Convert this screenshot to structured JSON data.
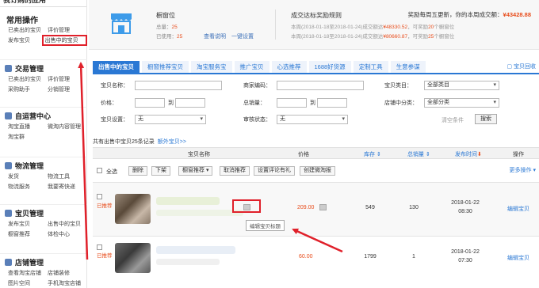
{
  "sidebar": {
    "top_title": "我订购的应用",
    "common": {
      "title": "常用操作",
      "rows": [
        [
          "已卖出的宝贝",
          "评价管理"
        ],
        [
          "发布宝贝",
          "出售中的宝贝"
        ]
      ]
    },
    "sections": [
      {
        "title": "交易管理",
        "rows": [
          [
            "已卖出的宝贝",
            "评价管理"
          ],
          [
            "采购助手",
            "分销管理"
          ]
        ]
      },
      {
        "title": "自运营中心",
        "rows": [
          [
            "淘宝直播",
            "微淘内容管理"
          ],
          [
            "淘宝群",
            ""
          ]
        ]
      },
      {
        "title": "物流管理",
        "rows": [
          [
            "发货",
            "物流工具"
          ],
          [
            "物流服务",
            "我要寄快递"
          ]
        ]
      },
      {
        "title": "宝贝管理",
        "rows": [
          [
            "发布宝贝",
            "出售中的宝贝"
          ],
          [
            "橱窗推荐",
            "体检中心"
          ]
        ]
      },
      {
        "title": "店铺管理",
        "rows": [
          [
            "查看淘宝店铺",
            "店铺装修"
          ],
          [
            "图片空间",
            "手机淘宝店铺"
          ]
        ]
      }
    ]
  },
  "topcard": {
    "title": "橱窗位",
    "total_label": "总量：",
    "total_value": "25",
    "used_label": "已使用：",
    "used_value": "25",
    "link_view": "查看说明",
    "link_setting": "一键设置",
    "rule_title": "成交达标奖励规则",
    "week1": "本周(2018-01-18至2018-01-24)成交额达",
    "week1_amount": "¥48330.52",
    "week1_tail": "，可奖励",
    "week1_num": "20",
    "week1_end": "个橱窗位",
    "week2": "本周(2018-01-18至2018-01-24)成交额达",
    "week2_amount": "¥80660.87",
    "week2_tail": "，可奖励",
    "week2_num": "25",
    "week2_end": "个橱窗位",
    "reward_label": "奖励每周五更新，你的本周成交额：",
    "reward_value": "¥43428.88"
  },
  "tabs": [
    "出售中的宝贝",
    "橱窗推荐宝贝",
    "淘宝服务宝",
    "推广宝贝",
    "心选推荐",
    "1688好货源",
    "定制工具",
    "生意参谋"
  ],
  "tab_back": "宝贝回收",
  "filters": {
    "name_label": "宝贝名称：",
    "code_label": "商家编码：",
    "cat_label": "宝贝类目：",
    "cat_value": "全部类目",
    "price_label": "价格：",
    "to": "到",
    "sales_label": "总销量：",
    "shopcat_label": "店铺中分类：",
    "shopcat_value": "全部分类",
    "setting_label": "宝贝设置：",
    "setting_value": "无",
    "audit_label": "审核状态：",
    "audit_value": "无",
    "clear": "清空条件",
    "search": "搜索"
  },
  "summary": {
    "text": "共有出售中宝贝25条记录",
    "link": "额外宝贝>>"
  },
  "table": {
    "headers": [
      "宝贝名称",
      "价格",
      "库存",
      "总销量",
      "发布时间",
      "操作"
    ],
    "batch": {
      "select_all": "全选",
      "delete": "删除",
      "off": "下架",
      "recommend": "橱窗推荐",
      "cancel_rec": "取消推荐",
      "set_review": "设置评论有礼",
      "create_rec": "创建微淘报",
      "more": "更多操作"
    },
    "rows": [
      {
        "rec": "已推荐",
        "price": "209.00",
        "stock": "549",
        "sales": "130",
        "date": "2018-01-22",
        "time": "08:30",
        "edit": "编辑宝贝"
      },
      {
        "rec": "已推荐",
        "price": "60.00",
        "stock": "1799",
        "sales": "1",
        "date": "2018-01-22",
        "time": "07:30",
        "edit": "编辑宝贝"
      }
    ],
    "tooltip": "编辑宝贝标题"
  }
}
